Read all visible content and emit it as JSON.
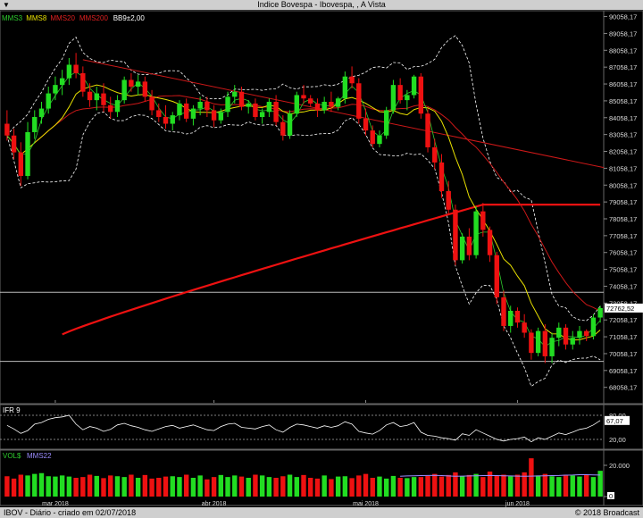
{
  "window": {
    "title": "Indice Bovespa - Ibovespa, , A Vista",
    "footer_left": "IBOV - Diário - criado em 02/07/2018",
    "footer_right": "© 2018 Broadcast"
  },
  "legend": [
    {
      "label": "MMS3",
      "color": "#2ecc2e"
    },
    {
      "label": "MMS8",
      "color": "#e8e000"
    },
    {
      "label": "MMS20",
      "color": "#e02020"
    },
    {
      "label": "MMS200",
      "color": "#e02020"
    },
    {
      "label": "BB9±2,00",
      "color": "#ffffff"
    }
  ],
  "colors": {
    "up": "#22dd22",
    "down": "#ee1111",
    "mms3": "#2ecc2e",
    "mms8": "#e8e000",
    "mms20": "#cc1818",
    "mms200": "#ee1111",
    "bb": "#ffffff",
    "trend": "#cc1818"
  },
  "last_price": "72762,52",
  "chart_data": [
    {
      "type": "candlestick",
      "name": "main",
      "x_labels": [
        "mar 2018",
        "abr 2018",
        "mai 2018",
        "jun 2018"
      ],
      "y_ticks": [
        "90058,17",
        "89058,17",
        "88058,17",
        "87058,17",
        "86058,17",
        "85058,17",
        "84058,17",
        "83058,17",
        "82058,17",
        "81058,17",
        "80058,17",
        "79058,17",
        "78058,17",
        "77058,17",
        "76058,17",
        "75058,17",
        "74058,17",
        "73058,17",
        "72058,17",
        "71058,17",
        "70058,17",
        "69058,17",
        "68058,17"
      ],
      "ylim": [
        67300,
        90300
      ],
      "candles": [
        [
          83700,
          84500,
          82700,
          83000
        ],
        [
          83000,
          83400,
          81600,
          82000
        ],
        [
          82000,
          82600,
          80000,
          80600
        ],
        [
          80600,
          83800,
          80400,
          83200
        ],
        [
          83200,
          84500,
          82800,
          84100
        ],
        [
          84100,
          85000,
          83700,
          84600
        ],
        [
          84600,
          85900,
          84300,
          85500
        ],
        [
          85500,
          86500,
          85100,
          86000
        ],
        [
          86000,
          86900,
          85400,
          86400
        ],
        [
          86400,
          87600,
          86000,
          87200
        ],
        [
          87200,
          87900,
          86400,
          86700
        ],
        [
          86700,
          87100,
          85300,
          85600
        ],
        [
          85600,
          86100,
          84700,
          85100
        ],
        [
          85100,
          85900,
          84500,
          85500
        ],
        [
          85500,
          86100,
          84400,
          84800
        ],
        [
          84800,
          85300,
          84000,
          84400
        ],
        [
          84400,
          85400,
          84100,
          85100
        ],
        [
          85100,
          86500,
          84900,
          86300
        ],
        [
          86300,
          86700,
          85600,
          85900
        ],
        [
          85900,
          86600,
          85400,
          86200
        ],
        [
          86200,
          86500,
          85000,
          85300
        ],
        [
          85300,
          85700,
          84200,
          84500
        ],
        [
          84500,
          84900,
          83800,
          84100
        ],
        [
          84100,
          84800,
          83400,
          83700
        ],
        [
          83700,
          84400,
          83300,
          84200
        ],
        [
          84200,
          85100,
          83900,
          84900
        ],
        [
          84900,
          85200,
          83800,
          84000
        ],
        [
          84000,
          84800,
          83600,
          84600
        ],
        [
          84600,
          85300,
          84200,
          85000
        ],
        [
          85000,
          85300,
          84100,
          84500
        ],
        [
          84500,
          84800,
          83500,
          83900
        ],
        [
          83900,
          84600,
          83700,
          84400
        ],
        [
          84400,
          85600,
          84100,
          85300
        ],
        [
          85300,
          86000,
          84900,
          85600
        ],
        [
          85600,
          85900,
          84500,
          84700
        ],
        [
          84700,
          85100,
          84300,
          84900
        ],
        [
          84900,
          85200,
          83900,
          84100
        ],
        [
          84100,
          84600,
          83700,
          84400
        ],
        [
          84400,
          85200,
          84100,
          85000
        ],
        [
          85000,
          85400,
          83600,
          83800
        ],
        [
          83800,
          84200,
          82700,
          83000
        ],
        [
          83000,
          84500,
          82800,
          84300
        ],
        [
          84300,
          85600,
          84100,
          85400
        ],
        [
          85400,
          86000,
          84900,
          85200
        ],
        [
          85200,
          85400,
          84700,
          84900
        ],
        [
          84900,
          85200,
          84100,
          84500
        ],
        [
          84500,
          85300,
          84300,
          85000
        ],
        [
          85000,
          85600,
          84400,
          84700
        ],
        [
          84700,
          85300,
          84500,
          85200
        ],
        [
          85200,
          86800,
          84900,
          86500
        ],
        [
          86500,
          87100,
          85800,
          86100
        ],
        [
          86100,
          86400,
          83700,
          84000
        ],
        [
          84000,
          84600,
          83000,
          83300
        ],
        [
          83300,
          83600,
          82300,
          82500
        ],
        [
          82500,
          83300,
          82300,
          83000
        ],
        [
          83000,
          84700,
          82800,
          84500
        ],
        [
          84500,
          86300,
          84300,
          86000
        ],
        [
          86000,
          86400,
          84900,
          85100
        ],
        [
          85100,
          85700,
          84500,
          85400
        ],
        [
          85400,
          86600,
          85200,
          86500
        ],
        [
          86500,
          86700,
          84000,
          84300
        ],
        [
          84300,
          84600,
          82000,
          82300
        ],
        [
          82300,
          82800,
          81000,
          81400
        ],
        [
          81400,
          81900,
          79300,
          79700
        ],
        [
          79700,
          80300,
          78300,
          78600
        ],
        [
          78600,
          78900,
          75300,
          75600
        ],
        [
          75600,
          77200,
          75400,
          77000
        ],
        [
          77000,
          77500,
          75600,
          75900
        ],
        [
          75900,
          78800,
          75700,
          78500
        ],
        [
          78500,
          79000,
          77000,
          77400
        ],
        [
          77400,
          77600,
          75500,
          75900
        ],
        [
          75900,
          76100,
          73000,
          73400
        ],
        [
          73400,
          73800,
          71400,
          71700
        ],
        [
          71700,
          72900,
          71300,
          72600
        ],
        [
          72600,
          72800,
          71600,
          71900
        ],
        [
          71900,
          72400,
          71000,
          71300
        ],
        [
          71300,
          71500,
          69700,
          70100
        ],
        [
          70100,
          71600,
          69900,
          71400
        ],
        [
          71400,
          71800,
          69500,
          69900
        ],
        [
          69900,
          71300,
          69500,
          71000
        ],
        [
          71000,
          71900,
          70500,
          71600
        ],
        [
          71600,
          71800,
          70300,
          70600
        ],
        [
          70600,
          71400,
          70300,
          71000
        ],
        [
          71000,
          71700,
          70600,
          71400
        ],
        [
          71400,
          71500,
          70800,
          71100
        ],
        [
          71100,
          72400,
          70900,
          72200
        ],
        [
          72200,
          72900,
          71900,
          72762.52
        ]
      ],
      "mms200": {
        "start": 71200,
        "end": 78900,
        "start_index": 8,
        "flat_from_index": 69
      },
      "trend_line": {
        "from": [
          11,
          87500
        ],
        "to": [
          95,
          81100
        ]
      },
      "h_lines": [
        73700,
        69600
      ]
    },
    {
      "type": "line",
      "name": "IFR 9",
      "y_ticks": [
        "80,00",
        "20,00"
      ],
      "ylim": [
        0,
        100
      ],
      "last_value": "67,07",
      "values": [
        55,
        46,
        35,
        42,
        58,
        62,
        70,
        74,
        76,
        80,
        58,
        44,
        52,
        48,
        40,
        45,
        56,
        60,
        54,
        50,
        44,
        40,
        46,
        52,
        55,
        48,
        52,
        56,
        50,
        44,
        42,
        52,
        58,
        60,
        50,
        48,
        46,
        52,
        56,
        44,
        38,
        50,
        58,
        56,
        52,
        48,
        54,
        50,
        54,
        64,
        58,
        40,
        36,
        33,
        42,
        56,
        62,
        52,
        55,
        62,
        38,
        30,
        28,
        24,
        22,
        18,
        34,
        30,
        44,
        36,
        28,
        20,
        16,
        20,
        22,
        26,
        14,
        24,
        20,
        28,
        36,
        32,
        38,
        45,
        48,
        56,
        67.07
      ]
    },
    {
      "type": "bar",
      "name": "VOL$ MMS22",
      "y_ticks": [
        "20.000",
        "0"
      ],
      "ylim": [
        0,
        28000
      ],
      "values": [
        13000,
        11500,
        14000,
        13500,
        14500,
        15000,
        13000,
        12800,
        13500,
        12800,
        12000,
        12500,
        14000,
        13200,
        11800,
        13500,
        13000,
        12500,
        14000,
        12000,
        13800,
        11500,
        12000,
        12800,
        13000,
        12500,
        14000,
        12000,
        13500,
        11000,
        12500,
        13800,
        12500,
        13500,
        12800,
        12000,
        14000,
        13500,
        12500,
        12000,
        13000,
        14000,
        12500,
        13800,
        12000,
        11500,
        13500,
        11200,
        12800,
        13000,
        11800,
        13500,
        14500,
        12000,
        12800,
        11500,
        13200,
        12000,
        11800,
        12500,
        12500,
        13200,
        14500,
        12800,
        13800,
        15500,
        13000,
        13800,
        14500,
        12500,
        16000,
        13500,
        14000,
        13000,
        14000,
        15500,
        24500,
        13500,
        14500,
        13000,
        12500,
        14000,
        13500,
        12800,
        14000,
        12500,
        16500
      ],
      "mms22": [
        13000,
        13200,
        13300,
        13400,
        13500,
        13600,
        13400,
        13200,
        13000,
        13100,
        13200,
        13300,
        13400,
        13500,
        13400,
        13300,
        13200,
        13100,
        13000,
        13100,
        13200,
        13300,
        13400,
        13500,
        13700,
        13800,
        14000,
        14000,
        13900,
        13800
      ]
    }
  ]
}
